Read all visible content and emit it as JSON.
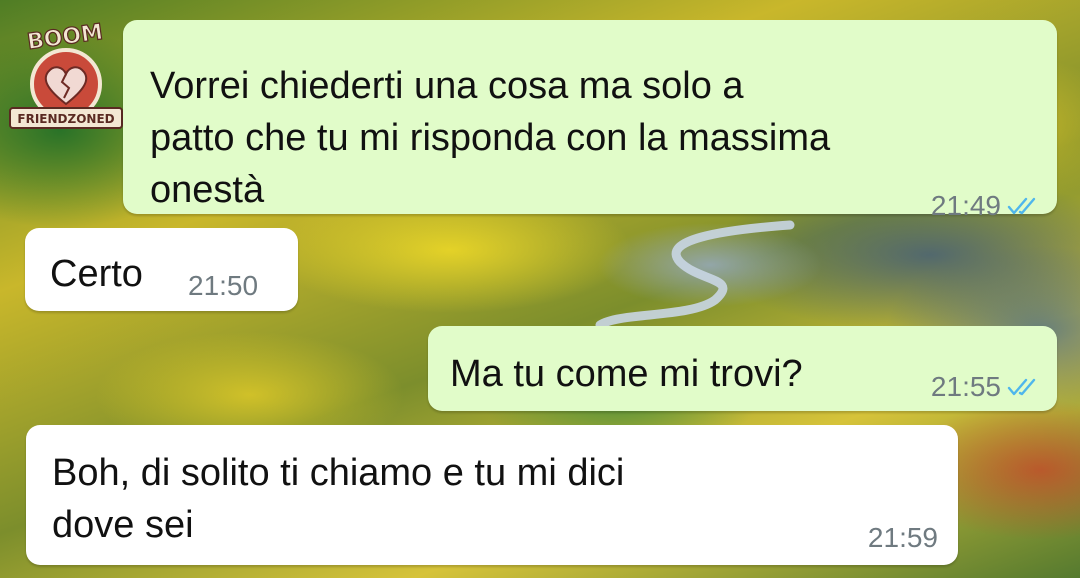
{
  "logo": {
    "top_text": "BOOM",
    "banner_text": "FRIENDZONED"
  },
  "messages": [
    {
      "direction": "outgoing",
      "text": "Vorrei chiederti una cosa ma solo a\npatto che tu mi risponda con la massima\nonestà",
      "time": "21:49",
      "status": "read"
    },
    {
      "direction": "incoming",
      "text": "Certo",
      "time": "21:50"
    },
    {
      "direction": "outgoing",
      "text": "Ma tu come mi trovi?",
      "time": "21:55",
      "status": "read"
    },
    {
      "direction": "incoming",
      "text": "Boh, di solito ti chiamo e tu mi dici\ndove sei",
      "time": "21:59"
    }
  ],
  "colors": {
    "outgoing_bubble": "#e1fcc9",
    "incoming_bubble": "#ffffff",
    "read_ticks": "#4fb6ec",
    "timestamp": "#6f7a80"
  }
}
